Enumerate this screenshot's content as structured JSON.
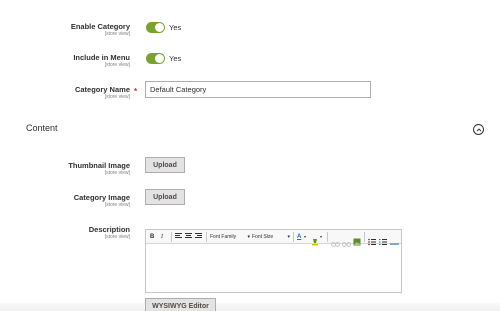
{
  "fields": {
    "enable_category": {
      "label": "Enable Category",
      "scope": "[store view]",
      "state": "Yes",
      "checked": true
    },
    "include_in_menu": {
      "label": "Include in Menu",
      "scope": "[store view]",
      "state": "Yes",
      "checked": true
    },
    "category_name": {
      "label": "Category Name",
      "scope": "[store view]",
      "required_mark": "*",
      "value": "Default Category"
    }
  },
  "content_section": {
    "title": "Content",
    "thumbnail": {
      "label": "Thumbnail Image",
      "scope": "[store view]",
      "button": "Upload"
    },
    "category_image": {
      "label": "Category Image",
      "scope": "[store view]",
      "button": "Upload"
    },
    "description": {
      "label": "Description",
      "scope": "[store view]",
      "toolbar": {
        "bold": "B",
        "italic": "I",
        "font_family": "Font Family",
        "font_size": "Font Size",
        "text_color": "A"
      },
      "wysiwyg_button": "WYSIWYG Editor"
    }
  },
  "colors": {
    "toggle_on": "#79a22e",
    "required": "#e22626",
    "button_bg": "#e3e3e3"
  }
}
